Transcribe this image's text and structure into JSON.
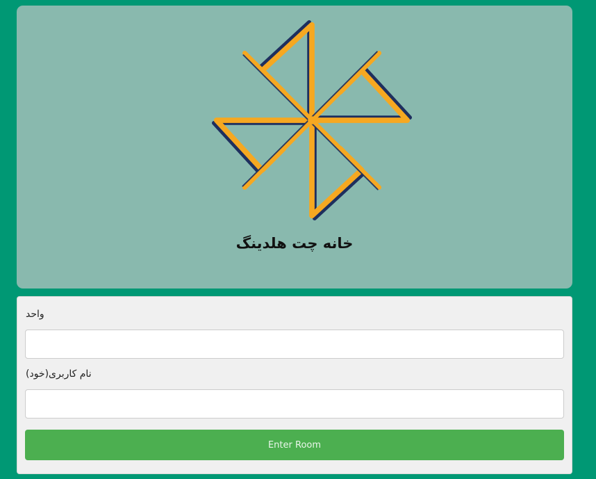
{
  "header": {
    "title": "خانه چت هلدینگ",
    "logo_icon": "pinwheel-logo-icon"
  },
  "form": {
    "unit_label": "واحد",
    "unit_value": "",
    "username_label": "نام کاربری(خود)",
    "username_value": "",
    "enter_button_label": "Enter Room"
  },
  "colors": {
    "background": "#009874",
    "header_card": "#89b9ae",
    "logo_orange": "#f6a821",
    "logo_navy": "#1e2f5e",
    "button_green": "#4caf50",
    "form_card": "#f0f0f0"
  }
}
